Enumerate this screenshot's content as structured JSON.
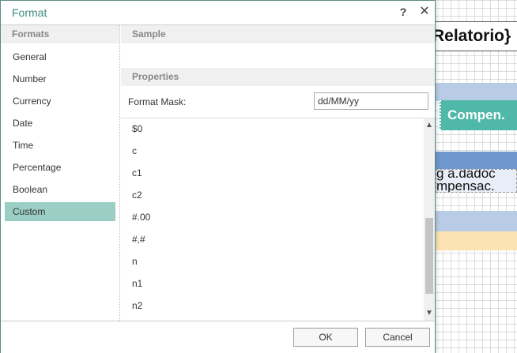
{
  "background": {
    "report_title": "Relatorio}",
    "column_header": "Compen.",
    "field_line1": "g a.dadoc",
    "field_line2": "mpensac."
  },
  "dialog": {
    "title": "Format",
    "help_label": "?",
    "close_label": "✕",
    "formats_header": "Formats",
    "formats": [
      "General",
      "Number",
      "Currency",
      "Date",
      "Time",
      "Percentage",
      "Boolean",
      "Custom"
    ],
    "selected_format": "Custom",
    "sample_header": "Sample",
    "properties_header": "Properties",
    "format_mask_label": "Format Mask:",
    "format_mask_value": "dd/MM/yy",
    "mask_options": [
      "$0",
      "c",
      "c1",
      "c2",
      "#.00",
      "#,#",
      "n",
      "n1",
      "n2"
    ],
    "scroll_up_label": "▲",
    "scroll_down_label": "▼",
    "ok_label": "OK",
    "cancel_label": "Cancel"
  },
  "colors": {
    "accent": "#3a8a80",
    "selection": "#9bcfc5",
    "column_header": "#4fb8a8"
  }
}
